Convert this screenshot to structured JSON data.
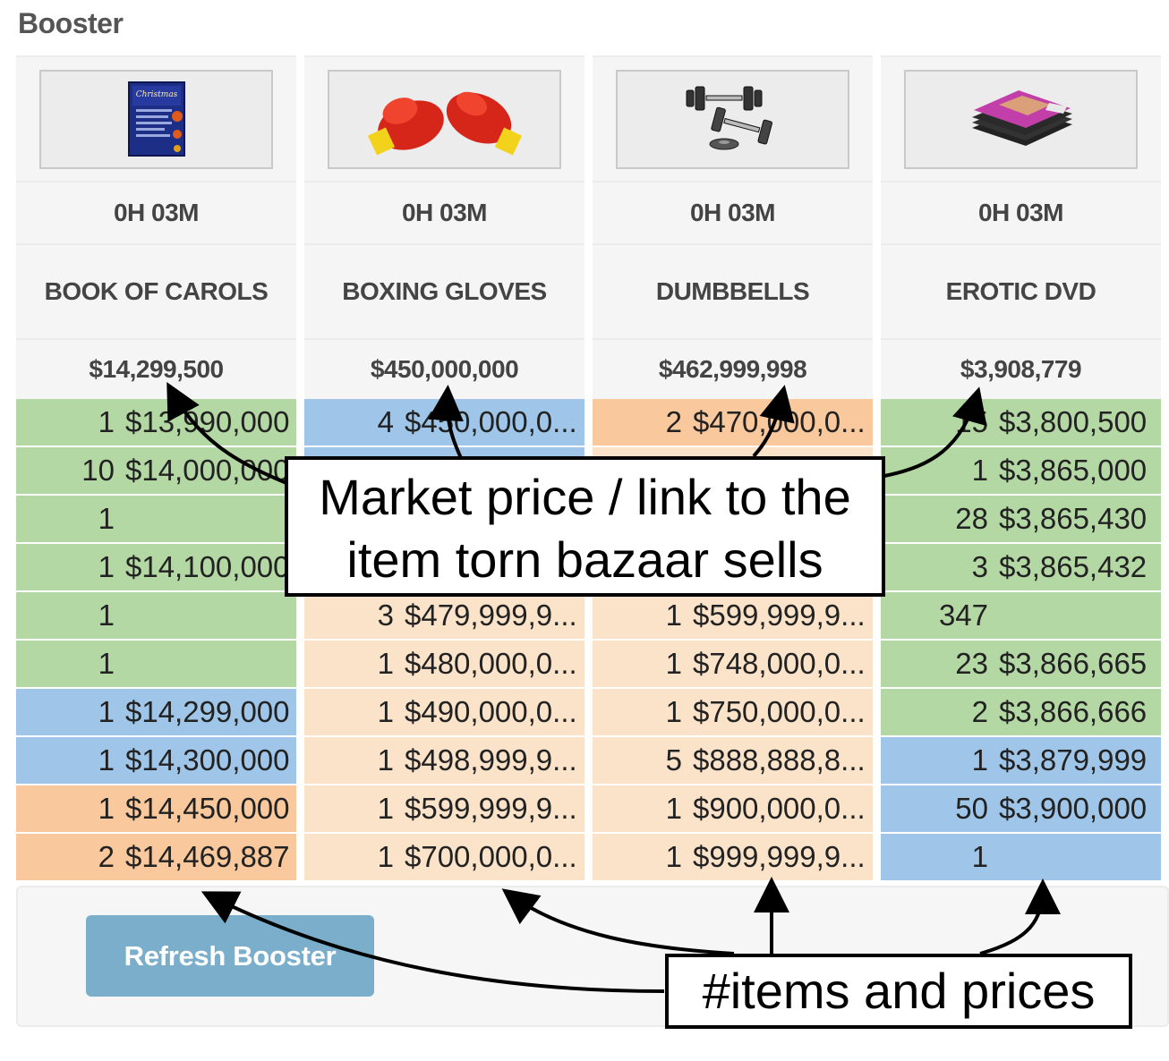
{
  "panel": {
    "title": "Booster"
  },
  "items": [
    {
      "time": "0H 03M",
      "name": "BOOK OF CAROLS",
      "market_price": "$14,299,500",
      "image_icon": "book-of-carols-icon",
      "listings": [
        {
          "qty": "1",
          "price": "$13,990,000",
          "color": "green"
        },
        {
          "qty": "10",
          "price": "$14,000,000",
          "color": "green"
        },
        {
          "qty": "1",
          "price": "",
          "color": "green"
        },
        {
          "qty": "1",
          "price": "$14,100,000",
          "color": "green"
        },
        {
          "qty": "1",
          "price": "",
          "color": "green"
        },
        {
          "qty": "1",
          "price": "",
          "color": "green"
        },
        {
          "qty": "1",
          "price": "$14,299,000",
          "color": "blue"
        },
        {
          "qty": "1",
          "price": "$14,300,000",
          "color": "blue"
        },
        {
          "qty": "1",
          "price": "$14,450,000",
          "color": "orange"
        },
        {
          "qty": "2",
          "price": "$14,469,887",
          "color": "orange"
        }
      ]
    },
    {
      "time": "0H 03M",
      "name": "BOXING GLOVES",
      "market_price": "$450,000,000",
      "image_icon": "boxing-gloves-icon",
      "listings": [
        {
          "qty": "4",
          "price": "$450,000,0...",
          "color": "blue"
        },
        {
          "qty": "",
          "price": "",
          "color": "blue"
        },
        {
          "qty": "",
          "price": "",
          "color": "peach"
        },
        {
          "qty": "",
          "price": "",
          "color": "peach"
        },
        {
          "qty": "3",
          "price": "$479,999,9...",
          "color": "peach"
        },
        {
          "qty": "1",
          "price": "$480,000,0...",
          "color": "peach"
        },
        {
          "qty": "1",
          "price": "$490,000,0...",
          "color": "peach"
        },
        {
          "qty": "1",
          "price": "$498,999,9...",
          "color": "peach"
        },
        {
          "qty": "1",
          "price": "$599,999,9...",
          "color": "peach"
        },
        {
          "qty": "1",
          "price": "$700,000,0...",
          "color": "peach"
        }
      ]
    },
    {
      "time": "0H 03M",
      "name": "DUMBBELLS",
      "market_price": "$462,999,998",
      "image_icon": "dumbbells-icon",
      "listings": [
        {
          "qty": "2",
          "price": "$470,000,0...",
          "color": "orange"
        },
        {
          "qty": "",
          "price": "",
          "color": "peach"
        },
        {
          "qty": "",
          "price": "",
          "color": "peach"
        },
        {
          "qty": "",
          "price": "",
          "color": "peach"
        },
        {
          "qty": "1",
          "price": "$599,999,9...",
          "color": "peach"
        },
        {
          "qty": "1",
          "price": "$748,000,0...",
          "color": "peach"
        },
        {
          "qty": "1",
          "price": "$750,000,0...",
          "color": "peach"
        },
        {
          "qty": "5",
          "price": "$888,888,8...",
          "color": "peach"
        },
        {
          "qty": "1",
          "price": "$900,000,0...",
          "color": "peach"
        },
        {
          "qty": "1",
          "price": "$999,999,9...",
          "color": "peach"
        }
      ]
    },
    {
      "time": "0H 03M",
      "name": "EROTIC DVD",
      "market_price": "$3,908,779",
      "image_icon": "erotic-dvd-icon",
      "listings": [
        {
          "qty": "15",
          "price": "$3,800,500",
          "color": "green"
        },
        {
          "qty": "1",
          "price": "$3,865,000",
          "color": "green"
        },
        {
          "qty": "28",
          "price": "$3,865,430",
          "color": "green"
        },
        {
          "qty": "3",
          "price": "$3,865,432",
          "color": "green"
        },
        {
          "qty": "347",
          "price": "",
          "color": "green"
        },
        {
          "qty": "23",
          "price": "$3,866,665",
          "color": "green"
        },
        {
          "qty": "2",
          "price": "$3,866,666",
          "color": "green"
        },
        {
          "qty": "1",
          "price": "$3,879,999",
          "color": "blue"
        },
        {
          "qty": "50",
          "price": "$3,900,000",
          "color": "blue"
        },
        {
          "qty": "1",
          "price": "",
          "color": "blue"
        }
      ]
    }
  ],
  "refresh_button": {
    "label": "Refresh Booster"
  },
  "annotations": {
    "market_price_line1": "Market price / link to the",
    "market_price_line2": "item torn bazaar sells",
    "items_and_prices": "#items and prices"
  },
  "colors": {
    "green": "#b4d8a4",
    "blue": "#9fc6e8",
    "orange": "#f9c89c",
    "peach": "#fbe3ca",
    "button": "#7aaecb"
  }
}
